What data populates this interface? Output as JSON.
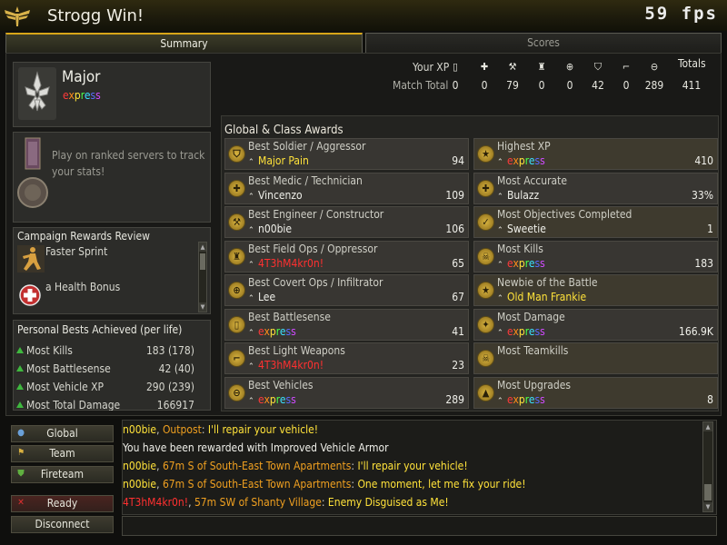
{
  "window": {
    "title": "Strogg Win!",
    "fps": "59 fps"
  },
  "tabs": {
    "summary": "Summary",
    "scores": "Scores"
  },
  "rank": {
    "name": "Major",
    "player": "express"
  },
  "promotion": {
    "text": "Play on ranked servers to track your stats!"
  },
  "campaign": {
    "title": "Campaign Rewards Review",
    "items": [
      {
        "label": "Faster Sprint",
        "icon": "sprint-icon"
      },
      {
        "label": "a Health Bonus",
        "icon": "health-icon"
      }
    ]
  },
  "personal_bests": {
    "title": "Personal Bests Achieved (per life)",
    "rows": [
      {
        "label": "Most Kills",
        "value": "183 (178)"
      },
      {
        "label": "Most Battlesense",
        "value": "42 (40)"
      },
      {
        "label": "Most Vehicle XP",
        "value": "290 (239)"
      },
      {
        "label": "Most Total Damage",
        "value": "166917"
      }
    ]
  },
  "xp": {
    "your_xp_label": "Your XP",
    "match_total_label": "Match Total",
    "totals_label": "Totals",
    "categories": [
      "battlesense-icon",
      "medic-icon",
      "engineer-icon",
      "fieldops-icon",
      "covertops-icon",
      "soldier-icon",
      "light-weapons-icon",
      "vehicle-icon"
    ],
    "values": [
      "0",
      "0",
      "79",
      "0",
      "0",
      "42",
      "0",
      "289"
    ],
    "total": "411"
  },
  "awards": {
    "title": "Global & Class Awards",
    "left": [
      {
        "title": "Best Soldier / Aggressor",
        "player": "Major Pain",
        "value": "94",
        "style": "yellow",
        "icon": "soldier-icon"
      },
      {
        "title": "Best Medic / Technician",
        "player": "Vincenzo",
        "value": "109",
        "style": "normal",
        "icon": "medic-icon"
      },
      {
        "title": "Best Engineer / Constructor",
        "player": "n00bie",
        "value": "106",
        "style": "normal",
        "icon": "engineer-icon"
      },
      {
        "title": "Best Field Ops / Oppressor",
        "player": "4T3hM4kr0n!",
        "value": "65",
        "style": "red",
        "icon": "fieldops-icon"
      },
      {
        "title": "Best Covert Ops / Infiltrator",
        "player": "Lee",
        "value": "67",
        "style": "normal",
        "icon": "covertops-icon"
      },
      {
        "title": "Best Battlesense",
        "player": "express",
        "value": "41",
        "style": "rainbow",
        "icon": "battlesense-icon"
      },
      {
        "title": "Best Light Weapons",
        "player": "4T3hM4kr0n!",
        "value": "23",
        "style": "red",
        "icon": "light-weapons-icon"
      },
      {
        "title": "Best Vehicles",
        "player": "express",
        "value": "289",
        "style": "rainbow",
        "icon": "vehicle-icon"
      }
    ],
    "right": [
      {
        "title": "Highest XP",
        "player": "express",
        "value": "410",
        "style": "rainbow",
        "icon": "xp-icon"
      },
      {
        "title": "Most Accurate",
        "player": "Bulazz",
        "value": "33%",
        "style": "normal",
        "icon": "accuracy-icon"
      },
      {
        "title": "Most Objectives Completed",
        "player": "Sweetie",
        "value": "1",
        "style": "normal",
        "icon": "objective-icon"
      },
      {
        "title": "Most Kills",
        "player": "express",
        "value": "183",
        "style": "rainbow",
        "icon": "kills-icon"
      },
      {
        "title": "Newbie of the Battle",
        "player": "Old Man Frankie",
        "value": "",
        "style": "yellow",
        "icon": "newbie-icon"
      },
      {
        "title": "Most Damage",
        "player": "express",
        "value": "166.9K",
        "style": "rainbow",
        "icon": "damage-icon"
      },
      {
        "title": "Most Teamkills",
        "player": "",
        "value": "",
        "style": "normal",
        "icon": "teamkill-icon"
      },
      {
        "title": "Most Upgrades",
        "player": "express",
        "value": "8",
        "style": "rainbow",
        "icon": "upgrade-icon"
      }
    ]
  },
  "chat_buttons": {
    "global": "Global",
    "team": "Team",
    "fireteam": "Fireteam",
    "ready": "Ready",
    "disconnect": "Disconnect"
  },
  "chat": [
    {
      "speaker": "n00bie",
      "location": "Outpost",
      "message": "I'll repair your vehicle!",
      "speaker_color": "#ffe23a",
      "loc_color": "#f0a020",
      "msg_color": "#ffe23a"
    },
    {
      "speaker": "",
      "location": "",
      "message": "You have been rewarded with Improved Vehicle Armor",
      "speaker_color": "#ffffff",
      "loc_color": "#ffffff",
      "msg_color": "#f0f0ea"
    },
    {
      "speaker": "n00bie",
      "location": "67m S of South-East Town Apartments",
      "message": "I'll repair your vehicle!",
      "speaker_color": "#ffe23a",
      "loc_color": "#f0a020",
      "msg_color": "#ffe23a"
    },
    {
      "speaker": "n00bie",
      "location": "67m S of South-East Town Apartments",
      "message": "One moment, let me fix your ride!",
      "speaker_color": "#ffe23a",
      "loc_color": "#f0a020",
      "msg_color": "#ffe23a"
    },
    {
      "speaker": "4T3hM4kr0n!",
      "location": "57m SW of Shanty Village",
      "message": "Enemy Disguised as Me!",
      "speaker_color": "#ff3030",
      "loc_color": "#f0a020",
      "msg_color": "#ffe23a"
    }
  ],
  "colors": {
    "accent": "#d9a618",
    "panel": "#2c2c29",
    "award_bg": "#383632"
  }
}
